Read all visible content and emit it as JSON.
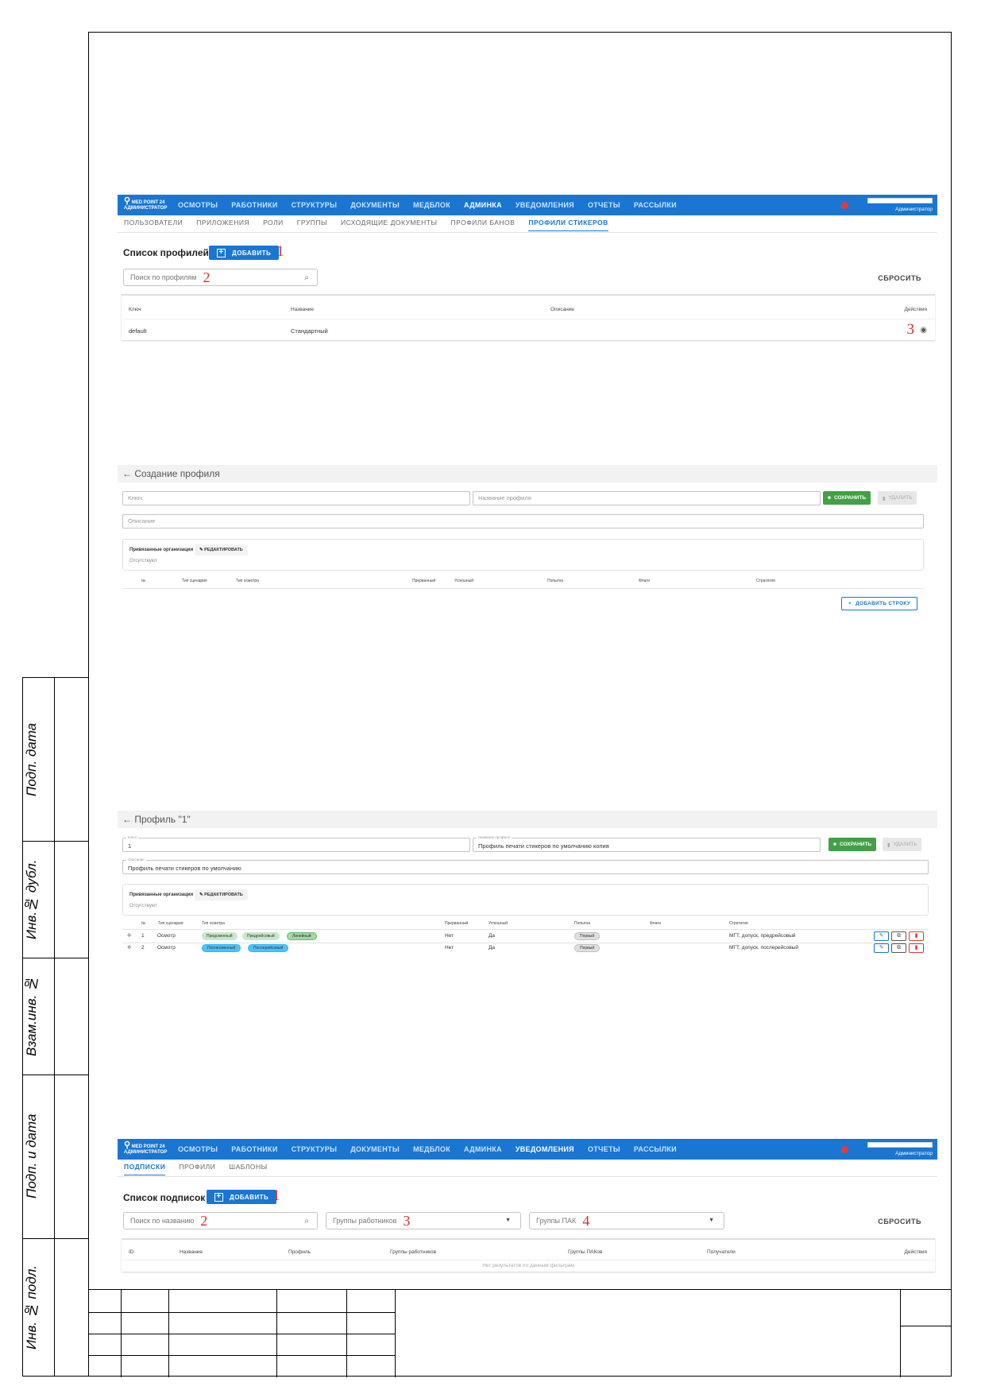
{
  "sidebar_labels": [
    "Подп. дата",
    "Инв.№ дубл.",
    "Взам.инв. №",
    "Подп. и дата",
    "Инв. № подл."
  ],
  "shot1": {
    "logo_top": "MED POINT 24",
    "logo_bottom": "АДМИНИСТРАТОР",
    "nav": [
      "ОСМОТРЫ",
      "РАБОТНИКИ",
      "СТРУКТУРЫ",
      "ДОКУМЕНТЫ",
      "МЕДБЛОК",
      "АДМИНКА",
      "УВЕДОМЛЕНИЯ",
      "ОТЧЕТЫ",
      "РАССЫЛКИ"
    ],
    "user": "Администратор",
    "subtabs": [
      "ПОЛЬЗОВАТЕЛИ",
      "ПРИЛОЖЕНИЯ",
      "РОЛИ",
      "ГРУППЫ",
      "ИСХОДЯЩИЕ ДОКУМЕНТЫ",
      "ПРОФИЛИ БАНОВ",
      "ПРОФИЛИ СТИКЕРОВ"
    ],
    "title": "Список профилей",
    "add_label": "ДОБАВИТЬ",
    "mark_add": "1",
    "search_placeholder": "Поиск по профилям",
    "mark_search": "2",
    "reset_label": "СБРОСИТЬ",
    "columns": [
      "Ключ",
      "Название",
      "Описание",
      "Действия"
    ],
    "row": {
      "key": "default",
      "name": "Стандартный"
    },
    "mark_actions": "3"
  },
  "shot2": {
    "title": "← Создание профиля",
    "key_placeholder": "Ключ",
    "name_placeholder": "Название профиля",
    "save_label": "СОХРАНИТЬ",
    "delete_label": "УДАЛИТЬ",
    "desc_placeholder": "Описание",
    "org_title": "Привязанные организации",
    "edit_label": "РЕДАКТИРОВАТЬ",
    "org_empty": "Отсутствуют",
    "columns": [
      "№",
      "Тип сценария",
      "Тип осмотра",
      "Прерванный",
      "Успешный",
      "Попытка",
      "Флаги",
      "Стратегия"
    ],
    "add_row_label": "ДОБАВИТЬ СТРОКУ"
  },
  "shot3": {
    "title": "← Профиль \"1\"",
    "key_label": "Ключ",
    "key_value": "1",
    "name_label": "Название профиля",
    "name_value": "Профиль печати стикеров по умолчанию копия",
    "save_label": "СОХРАНИТЬ",
    "delete_label": "УДАЛИТЬ",
    "desc_label": "Описание",
    "desc_value": "Профиль печати стикеров по умолчанию",
    "org_title": "Привязанные организации",
    "edit_label": "РЕДАКТИРОВАТЬ",
    "org_empty": "Отсутствуют",
    "columns": [
      "№",
      "Тип сценария",
      "Тип осмотра",
      "Прерванный",
      "Успешный",
      "Попытка",
      "Флаги",
      "Стратегия"
    ],
    "rows": [
      {
        "n": "1",
        "scenario": "Осмотр",
        "chips": [
          "Предсменный",
          "Предрейсовый",
          "Линейный"
        ],
        "interrupted": "Нет",
        "success": "Да",
        "attempt": "Первый",
        "strategy": "МГТ, допуск, предрейсовый"
      },
      {
        "n": "2",
        "scenario": "Осмотр",
        "chips": [
          "Послесменный",
          "Послерейсовый"
        ],
        "interrupted": "Нет",
        "success": "Да",
        "attempt": "Первый",
        "strategy": "МГТ, допуск, послерейсовый"
      }
    ]
  },
  "shot4": {
    "logo_top": "MED POINT 24",
    "logo_bottom": "АДМИНИСТРАТОР",
    "nav": [
      "ОСМОТРЫ",
      "РАБОТНИКИ",
      "СТРУКТУРЫ",
      "ДОКУМЕНТЫ",
      "МЕДБЛОК",
      "АДМИНКА",
      "УВЕДОМЛЕНИЯ",
      "ОТЧЕТЫ",
      "РАССЫЛКИ"
    ],
    "user": "Администратор",
    "subtabs": [
      "ПОДПИСКИ",
      "ПРОФИЛИ",
      "ШАБЛОНЫ"
    ],
    "title": "Список подписок",
    "add_label": "ДОБАВИТЬ",
    "mark_add": "1",
    "search_placeholder": "Поиск по названию",
    "mark_search": "2",
    "workers_placeholder": "Группы работников",
    "mark_workers": "3",
    "pak_placeholder": "Группы ПАК",
    "mark_pak": "4",
    "reset_label": "СБРОСИТЬ",
    "columns": [
      "ID",
      "Название",
      "Профиль",
      "Группы работников",
      "Группы ПАКов",
      "Получатели",
      "Действия"
    ],
    "empty_text": "Нет результатов по данным фильтрам"
  },
  "colors": {
    "primary": "#1976d2",
    "success": "#43a047",
    "danger": "#e53935",
    "annotation": "#d32f2f"
  }
}
